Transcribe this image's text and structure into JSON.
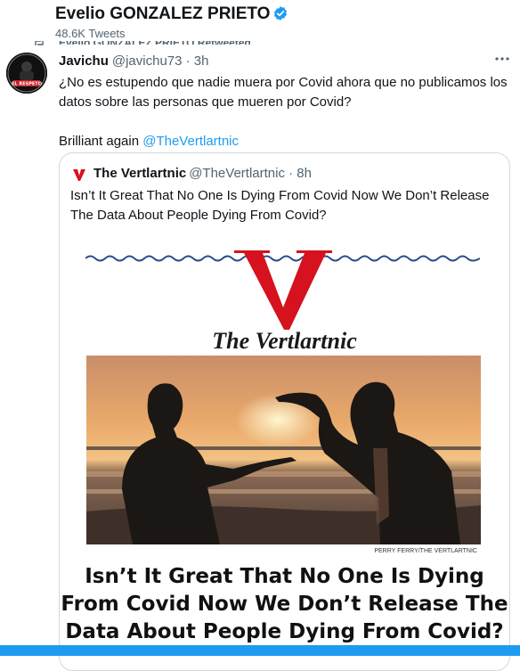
{
  "header": {
    "name": "Evelio GONZALEZ PRIETO",
    "tweet_count": "48.6K Tweets",
    "retweeted_label": "Evelio GONZALEZ PRIETO Retweeted"
  },
  "avatar_text": "EL RESPETO",
  "tweet": {
    "author_name": "Javichu",
    "author_meta": "@javichu73 · 3h",
    "text_line1": "¿No es estupendo que nadie muera por Covid ahora que no publicamos los datos sobre las personas que mueren por Covid?",
    "text_line2": "Brilliant again",
    "mention": "@TheVertlartnic"
  },
  "quote": {
    "author_name": "The Vertlartnic",
    "author_meta": "@TheVertlartnic · 8h",
    "text": "Isn’t It Great That No One Is Dying From Covid Now We Don’t Release The Data About People Dying From Covid?",
    "brand": "The Vertlartnic",
    "photo_credit": "PERRY FERRY/THE VERTLARTNIC",
    "headline": "Isn’t It Great That No One Is Dying From Covid Now We Don’t Release The Data About People Dying From Covid?"
  },
  "colors": {
    "accent": "#1d9bf0",
    "brand_red": "#d5121e",
    "wave_blue": "#2a4b8d"
  },
  "icons": {
    "verified": "verified-badge-icon",
    "more": "more-icon",
    "retweet": "retweet-icon"
  }
}
